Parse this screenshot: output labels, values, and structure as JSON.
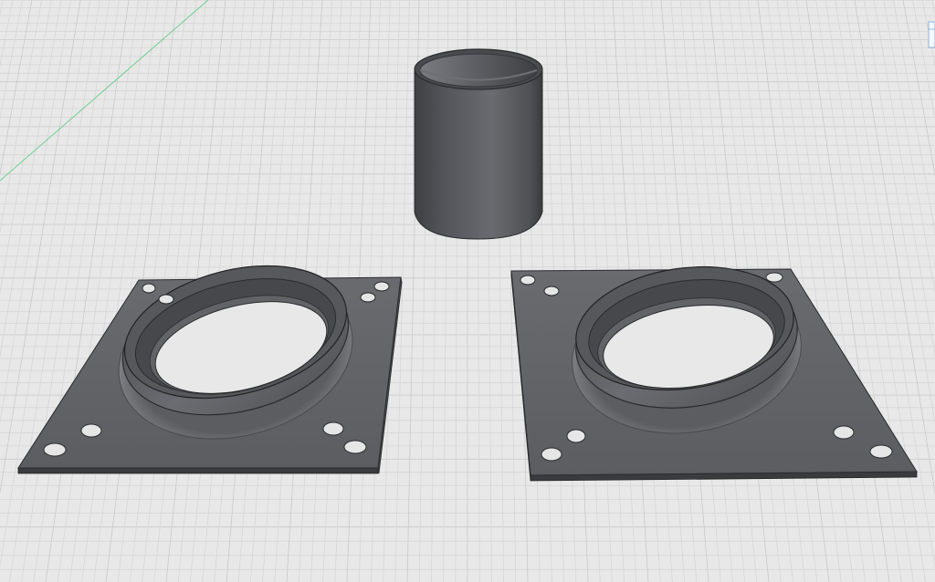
{
  "viewport": {
    "background": "#e8e8e8",
    "grid_minor_color": "#d6d6d6",
    "grid_major_color": "#c9c9c9",
    "axis_color": "#6fcf8f"
  },
  "scene": {
    "objects": [
      {
        "name": "tube",
        "kind": "cylinder"
      },
      {
        "name": "left-flange-plate",
        "kind": "flange",
        "mounting_holes": 8
      },
      {
        "name": "right-flange-plate",
        "kind": "flange",
        "mounting_holes": 8
      }
    ],
    "material_color": "#5a5b5f"
  },
  "viewcube_icon": "viewcube-edge-icon"
}
